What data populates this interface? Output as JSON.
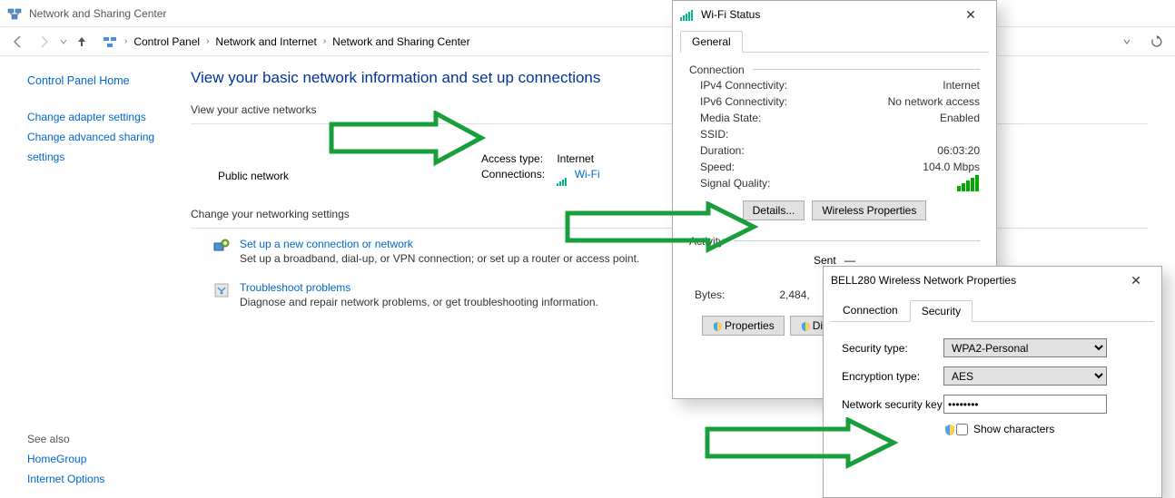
{
  "window": {
    "title": "Network and Sharing Center",
    "breadcrumb": [
      "Control Panel",
      "Network and Internet",
      "Network and Sharing Center"
    ]
  },
  "sidebar": {
    "home": "Control Panel Home",
    "links": [
      "Change adapter settings",
      "Change advanced sharing settings"
    ],
    "see_also_label": "See also",
    "see_also": [
      "HomeGroup",
      "Internet Options"
    ]
  },
  "main": {
    "title": "View your basic network information and set up connections",
    "active_head": "View your active networks",
    "net_type": "Public network",
    "access_label": "Access type:",
    "access_value": "Internet",
    "conn_label": "Connections:",
    "conn_value": "Wi-Fi",
    "change_head": "Change your networking settings",
    "task1_link": "Set up a new connection or network",
    "task1_desc": "Set up a broadband, dial-up, or VPN connection; or set up a router or access point.",
    "task2_link": "Troubleshoot problems",
    "task2_desc": "Diagnose and repair network problems, or get troubleshooting information."
  },
  "wifi_status": {
    "title": "Wi-Fi Status",
    "tab_general": "General",
    "section_conn": "Connection",
    "ipv4_l": "IPv4 Connectivity:",
    "ipv4_v": "Internet",
    "ipv6_l": "IPv6 Connectivity:",
    "ipv6_v": "No network access",
    "media_l": "Media State:",
    "media_v": "Enabled",
    "ssid_l": "SSID:",
    "ssid_v": "",
    "dur_l": "Duration:",
    "dur_v": "06:03:20",
    "speed_l": "Speed:",
    "speed_v": "104.0 Mbps",
    "sig_l": "Signal Quality:",
    "btn_details": "Details...",
    "btn_wprops": "Wireless Properties",
    "section_act": "Activity",
    "sent_l": "Sent",
    "bytes_l": "Bytes:",
    "bytes_v": "2,484,",
    "btn_props": "Properties",
    "btn_disable": "Disab"
  },
  "props": {
    "title": "BELL280 Wireless Network Properties",
    "tab_conn": "Connection",
    "tab_sec": "Security",
    "sectype_l": "Security type:",
    "sectype_v": "WPA2-Personal",
    "enctype_l": "Encryption type:",
    "enctype_v": "AES",
    "key_l": "Network security key",
    "key_v": "••••••••",
    "show_l": "Show characters"
  }
}
